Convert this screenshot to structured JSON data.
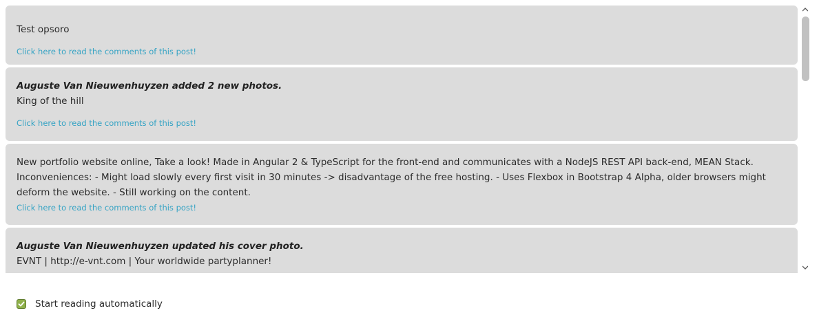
{
  "feed": {
    "posts": [
      {
        "heading": "",
        "text": "Test opsoro",
        "link": "Click here to read the comments of this post!"
      },
      {
        "heading": "Auguste Van Nieuwenhuyzen added 2 new photos.",
        "text": "King of the hill",
        "link": "Click here to read the comments of this post!"
      },
      {
        "heading": "",
        "text": "New portfolio website online, Take a look! Made in Angular 2 & TypeScript for the front-end and communicates with a NodeJS REST API back-end, MEAN Stack. Inconveniences: - Might load slowly every first visit in 30 minutes -> disadvantage of the free hosting. - Uses Flexbox in Bootstrap 4 Alpha, older browsers might deform the website. - Still working on the content.",
        "link": "Click here to read the comments of this post!"
      },
      {
        "heading": "Auguste Van Nieuwenhuyzen updated his cover photo.",
        "text": "EVNT | http://e-vnt.com | Your worldwide partyplanner!",
        "link": ""
      }
    ]
  },
  "scrollbar": {
    "up_icon": "chevron-up-icon",
    "down_icon": "chevron-down-icon"
  },
  "auto_read": {
    "label": "Start reading automatically",
    "checked": true,
    "icon": "checkmark-icon",
    "color": "#8fb04a"
  },
  "colors": {
    "card_bg": "#dcdcdc",
    "link": "#35a3c4"
  }
}
